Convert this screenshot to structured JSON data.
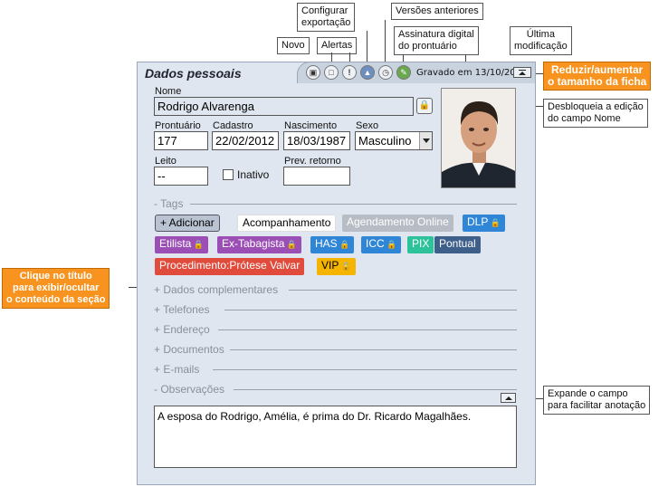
{
  "callouts": {
    "novo": "Novo",
    "alertas": "Alertas",
    "configurar": "Configurar\nexportação",
    "versoes": "Versões anteriores",
    "assinatura": "Assinatura digital\ndo prontuário",
    "ultima": "Última\nmodificação",
    "reduzir": "Reduzir/aumentar\no tamanho da ficha",
    "desbloqueia": "Desbloqueia a edição\ndo campo Nome",
    "clique": "Clique no título\npara exibir/ocultar\no conteúdo da seção",
    "expande": "Expande o campo\npara facilitar anotação"
  },
  "panel": {
    "title": "Dados pessoais",
    "saved_text": "Gravado em 13/10/2022"
  },
  "form": {
    "nome_label": "Nome",
    "nome_value": "Rodrigo Alvarenga",
    "prontuario_label": "Prontuário",
    "prontuario_value": "177",
    "cadastro_label": "Cadastro",
    "cadastro_value": "22/02/2012",
    "nascimento_label": "Nascimento",
    "nascimento_value": "18/03/1987",
    "sexo_label": "Sexo",
    "sexo_value": "Masculino",
    "leito_label": "Leito",
    "leito_value": "--",
    "inativo_label": "Inativo",
    "prev_retorno_label": "Prev. retorno",
    "prev_retorno_value": ""
  },
  "tags_section": {
    "header": "- Tags",
    "add_label": "+ Adicionar",
    "tags": [
      {
        "label": "Acompanhamento",
        "color": "#ffffff",
        "text": "#000000",
        "locked": false
      },
      {
        "label": "Agendamento Online",
        "color": "#b8bcc4",
        "text": "#ffffff",
        "locked": false
      },
      {
        "label": "DLP",
        "color": "#2f86d6",
        "text": "#ffffff",
        "locked": true
      },
      {
        "label": "Etilista",
        "color": "#9b4fb5",
        "text": "#ffffff",
        "locked": true
      },
      {
        "label": "Ex-Tabagista",
        "color": "#9b4fb5",
        "text": "#ffffff",
        "locked": true
      },
      {
        "label": "HAS",
        "color": "#2f86d6",
        "text": "#ffffff",
        "locked": true
      },
      {
        "label": "ICC",
        "color": "#2f86d6",
        "text": "#ffffff",
        "locked": true
      },
      {
        "label": "PIX",
        "color": "#2cc29a",
        "text": "#ffffff",
        "locked": false
      },
      {
        "label": "Pontual",
        "color": "#3e5f8a",
        "text": "#ffffff",
        "locked": false
      },
      {
        "label": "Procedimento:Prótese Valvar",
        "color": "#e04b3c",
        "text": "#ffffff",
        "locked": false
      },
      {
        "label": "VIP",
        "color": "#f4b400",
        "text": "#000000",
        "locked": true
      }
    ]
  },
  "sections": [
    "+ Dados complementares",
    "+ Telefones",
    "+ Endereço",
    "+ Documentos",
    "+ E-mails"
  ],
  "observacoes": {
    "header": "- Observações",
    "text": "A esposa do Rodrigo, Amélia, é prima do Dr. Ricardo Magalhães."
  },
  "icons": [
    "save-icon",
    "new-document-icon",
    "alert-icon",
    "export-icon",
    "history-icon",
    "signature-icon"
  ],
  "accent_colors": {
    "orange": "#f7931e",
    "panel_bg": "#dfe6ef"
  }
}
